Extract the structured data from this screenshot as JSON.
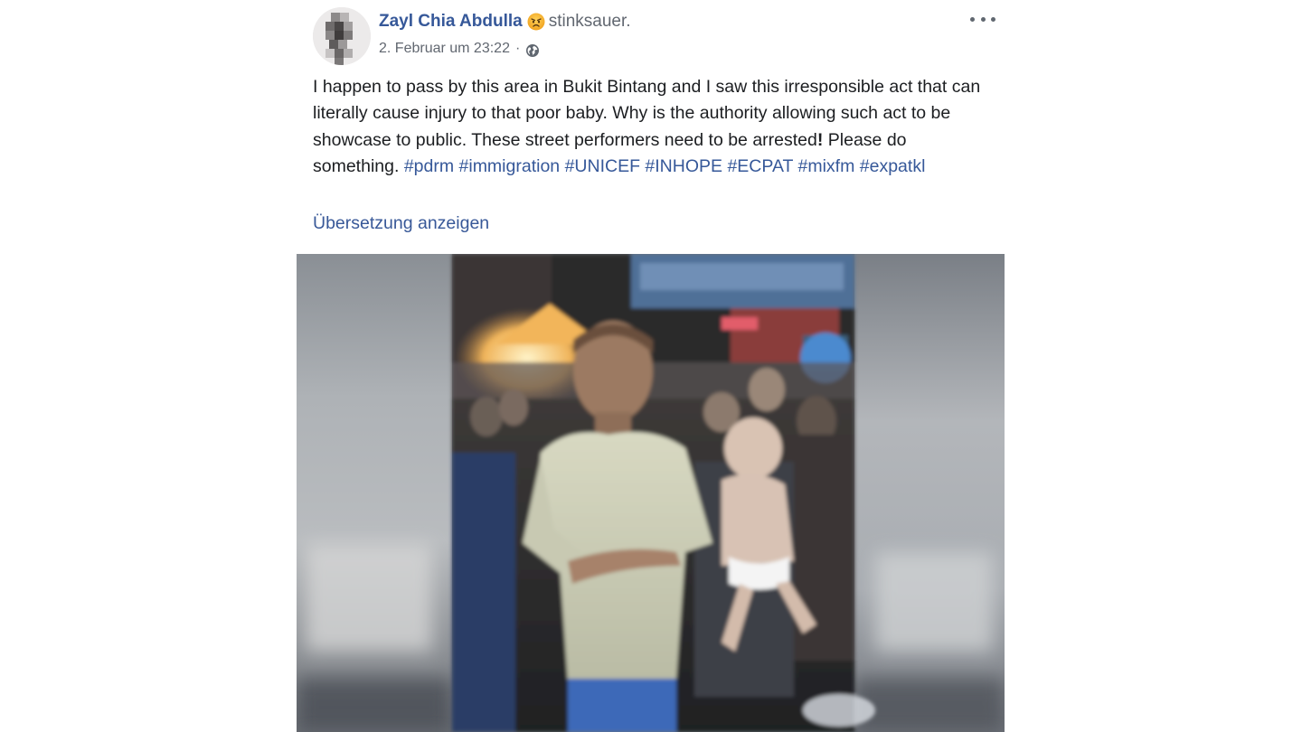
{
  "post": {
    "author_name": "Zayl Chia Abdulla",
    "feeling_icon": "angry-face-emoji",
    "feeling_text": "stinksauer.",
    "timestamp": "2. Februar um 23:22",
    "separator": "·",
    "privacy_icon": "globe-icon",
    "more_icon": "more-options-icon",
    "text_segments": [
      {
        "text": "I happen to pass by this area in Bukit Bintang and I saw this irresponsible act that can literally cause injury to that poor baby. Why is the authority allowing such act to be showcase to public. These street performers need to be arrested",
        "type": "plain"
      },
      {
        "text": "!",
        "type": "bold"
      },
      {
        "text": " Please do something. ",
        "type": "plain"
      }
    ],
    "hashtags": [
      "#pdrm",
      "#immigration",
      "#UNICEF",
      "#INHOPE",
      "#ECPAT",
      "#mixfm",
      "#expatkl"
    ],
    "translate_label": "Übersetzung anzeigen"
  },
  "colors": {
    "link_blue": "#365899",
    "secondary_text": "#616770",
    "body_text": "#1c1e21"
  }
}
